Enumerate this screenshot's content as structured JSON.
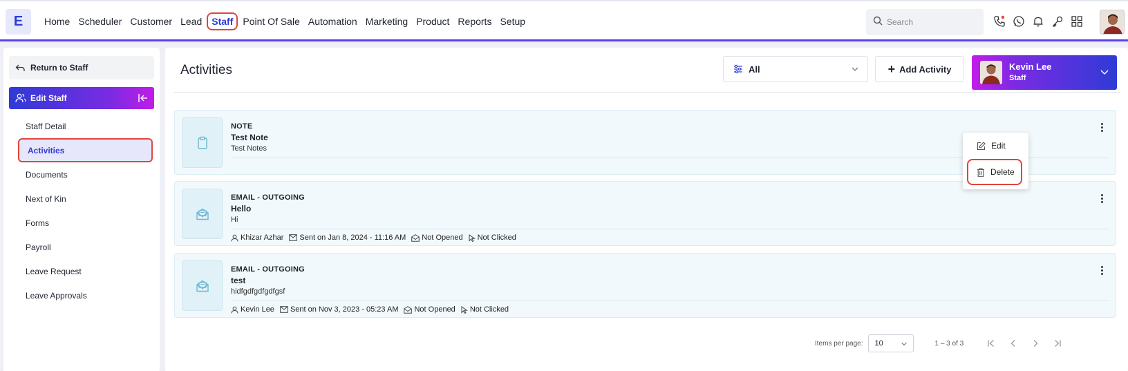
{
  "app": {
    "logo_letter": "E",
    "brand_color": "#2f3bd6",
    "accent_gradient": [
      "#2f3bd6",
      "#7a2be2",
      "#c21ce8"
    ],
    "highlight_color": "#e0453a"
  },
  "nav": {
    "items": [
      {
        "label": "Home"
      },
      {
        "label": "Scheduler"
      },
      {
        "label": "Customer"
      },
      {
        "label": "Lead"
      },
      {
        "label": "Staff",
        "active": true
      },
      {
        "label": "Point Of Sale"
      },
      {
        "label": "Automation"
      },
      {
        "label": "Marketing"
      },
      {
        "label": "Product"
      },
      {
        "label": "Reports"
      },
      {
        "label": "Setup"
      }
    ],
    "search_placeholder": "Search",
    "icons": [
      "phone-icon",
      "whatsapp-icon",
      "bell-icon",
      "key-icon",
      "grid-icon"
    ]
  },
  "sidebar": {
    "return_label": "Return to Staff",
    "section_label": "Edit Staff",
    "items": [
      {
        "label": "Staff Detail"
      },
      {
        "label": "Activities",
        "active": true
      },
      {
        "label": "Documents"
      },
      {
        "label": "Next of Kin"
      },
      {
        "label": "Forms"
      },
      {
        "label": "Payroll"
      },
      {
        "label": "Leave Request"
      },
      {
        "label": "Leave Approvals"
      }
    ]
  },
  "main": {
    "title": "Activities",
    "filter_value": "All",
    "add_label": "Add Activity",
    "user": {
      "name": "Kevin Lee",
      "role": "Staff"
    },
    "activities": [
      {
        "type": "NOTE",
        "title": "Test Note",
        "body": "Test Notes",
        "icon": "clipboard-icon"
      },
      {
        "type": "EMAIL - OUTGOING",
        "title": "Hello",
        "body": "Hi",
        "icon": "mail-open-icon",
        "author": "Khizar Azhar",
        "sent": "Sent on Jan 8, 2024 - 11:16 AM",
        "opened": "Not Opened",
        "clicked": "Not Clicked"
      },
      {
        "type": "EMAIL - OUTGOING",
        "title": "test",
        "body": "hidfgdfgdfgdfgsf",
        "icon": "mail-open-icon",
        "author": "Kevin Lee",
        "sent": "Sent on Nov 3, 2023 - 05:23 AM",
        "opened": "Not Opened",
        "clicked": "Not Clicked"
      }
    ],
    "context_menu": {
      "edit_label": "Edit",
      "delete_label": "Delete"
    },
    "pagination": {
      "items_per_page_label": "Items per page:",
      "items_per_page": "10",
      "range": "1 – 3 of 3"
    }
  }
}
